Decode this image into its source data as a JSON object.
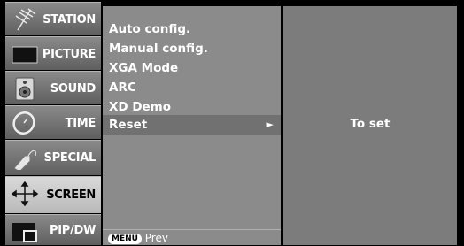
{
  "sidebar": {
    "items": [
      {
        "label": "STATION",
        "icon": "antenna-icon"
      },
      {
        "label": "PICTURE",
        "icon": "picture-icon"
      },
      {
        "label": "SOUND",
        "icon": "speaker-icon"
      },
      {
        "label": "TIME",
        "icon": "clock-icon"
      },
      {
        "label": "SPECIAL",
        "icon": "tag-icon"
      },
      {
        "label": "SCREEN",
        "icon": "screen-arrows-icon",
        "active": true
      },
      {
        "label": "PIP/DW",
        "icon": "pip-icon"
      }
    ]
  },
  "menu": {
    "items": [
      {
        "label": "Auto config."
      },
      {
        "label": "Manual config."
      },
      {
        "label": "XGA Mode"
      },
      {
        "label": "ARC"
      },
      {
        "label": "XD Demo"
      },
      {
        "label": "Reset",
        "selected": true,
        "arrow": "►"
      }
    ],
    "footer": {
      "key": "MENU",
      "text": "Prev"
    }
  },
  "detail": {
    "label": "To set"
  }
}
